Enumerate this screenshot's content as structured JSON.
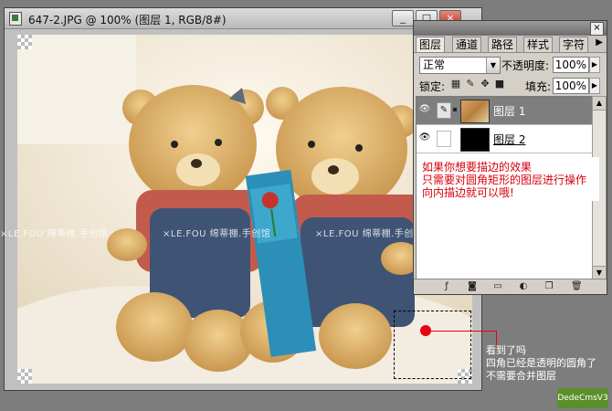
{
  "document_window": {
    "title": "647-2.JPG @ 100% (图层 1, RGB/8#)",
    "minimize": "_",
    "maximize": "□",
    "close": "×"
  },
  "layers_palette": {
    "close": "×",
    "tabs": [
      {
        "label": "图层"
      },
      {
        "label": "通道"
      },
      {
        "label": "路径"
      },
      {
        "label": "样式"
      },
      {
        "label": "字符"
      }
    ],
    "menu_arrow": "▶",
    "blend_mode": "正常",
    "opacity_label": "不透明度:",
    "opacity": "100%",
    "lock_label": "锁定:",
    "fill_label": "填充:",
    "fill": "100%",
    "layers": [
      {
        "name": "图层 1",
        "selected": true
      },
      {
        "name": "图层 2",
        "selected": false
      }
    ],
    "annotation": [
      "如果你想要描边的效果",
      "只需要对圆角矩形的图层进行操作",
      "向内描边就可以哦!"
    ]
  },
  "watermark": "×LE.FOU  绵蒂棚.手创馆",
  "callout": {
    "lines": [
      "看到了吗",
      "四角已经是透明的圆角了",
      "不需要合并图层"
    ]
  },
  "brand": "DedeCmsV3",
  "colors": {
    "annotation_red": "#d8000c",
    "selected_layer": "#7e7e7e"
  }
}
